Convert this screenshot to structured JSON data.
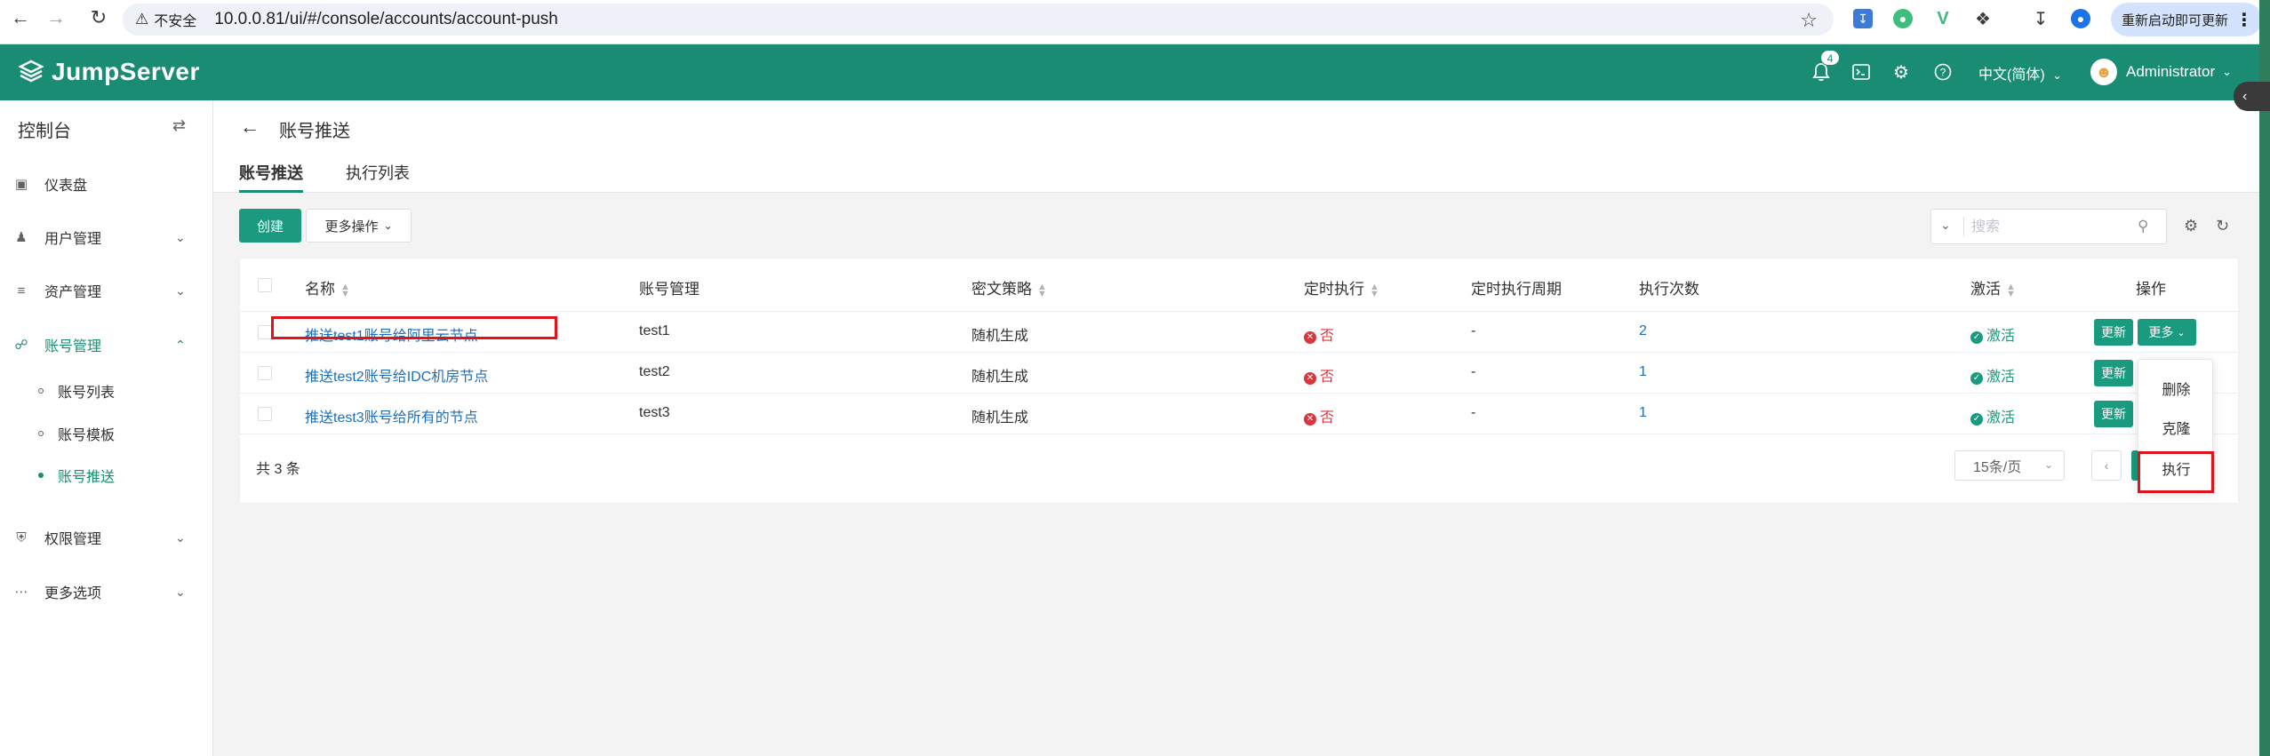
{
  "browser": {
    "security_label": "不安全",
    "url": "10.0.0.81/ui/#/console/accounts/account-push",
    "update_label": "重新启动即可更新"
  },
  "header": {
    "logo_text": "JumpServer",
    "notification_count": "4",
    "language": "中文(简体)",
    "user_name": "Administrator",
    "brand_color": "#1a8c73"
  },
  "sidebar": {
    "title": "控制台",
    "items": [
      {
        "label": "仪表盘",
        "icon": "dashboard-icon"
      },
      {
        "label": "用户管理",
        "icon": "users-icon"
      },
      {
        "label": "资产管理",
        "icon": "assets-icon"
      },
      {
        "label": "账号管理",
        "icon": "accounts-icon"
      },
      {
        "label": "权限管理",
        "icon": "permissions-icon"
      },
      {
        "label": "更多选项",
        "icon": "more-options-icon"
      }
    ],
    "account_sub": [
      "账号列表",
      "账号模板",
      "账号推送"
    ]
  },
  "page": {
    "title": "账号推送",
    "tabs": [
      "账号推送",
      "执行列表"
    ]
  },
  "toolbar": {
    "create_label": "创建",
    "more_actions_label": "更多操作",
    "search_placeholder": "搜索"
  },
  "table": {
    "headers": [
      "名称",
      "账号管理",
      "密文策略",
      "定时执行",
      "定时执行周期",
      "执行次数",
      "激活",
      "操作"
    ],
    "rows": [
      {
        "name": "推送test1账号给阿里云节点",
        "account": "test1",
        "policy": "随机生成",
        "scheduled": "否",
        "period": "-",
        "count": "2",
        "active": "激活"
      },
      {
        "name": "推送test2账号给IDC机房节点",
        "account": "test2",
        "policy": "随机生成",
        "scheduled": "否",
        "period": "-",
        "count": "1",
        "active": "激活"
      },
      {
        "name": "推送test3账号给所有的节点",
        "account": "test3",
        "policy": "随机生成",
        "scheduled": "否",
        "period": "-",
        "count": "1",
        "active": "激活"
      }
    ],
    "update_label": "更新",
    "more_label": "更多",
    "total": "共 3 条",
    "page_size": "15条/页"
  },
  "dropdown": {
    "items": [
      "删除",
      "克隆",
      "执行"
    ]
  },
  "highlight_color": "#e0131c"
}
